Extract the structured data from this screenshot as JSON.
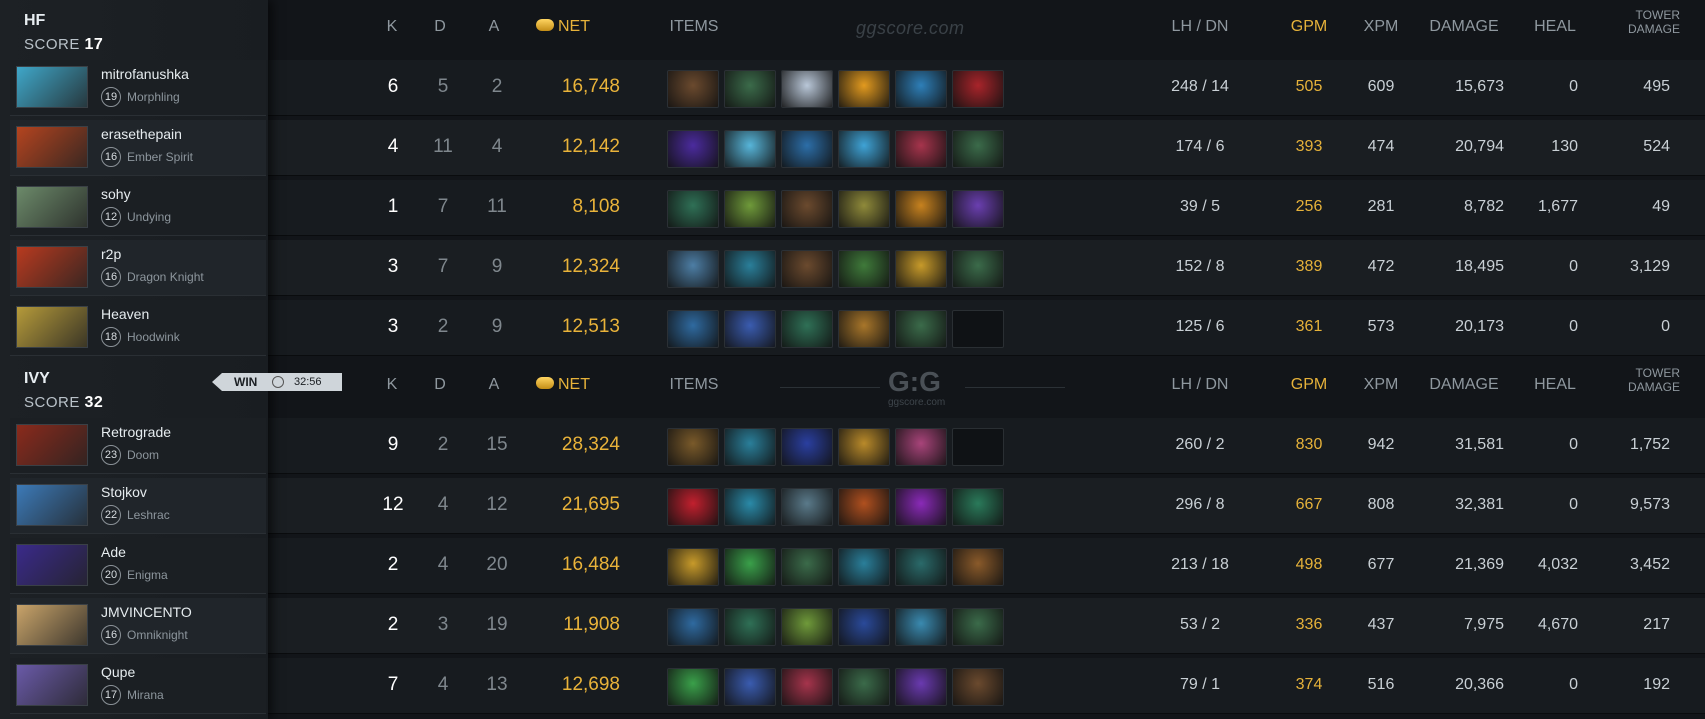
{
  "watermark_text": "ggscore.com",
  "watermark_logo": "G:G",
  "watermark_logo_sub": "ggscore.com",
  "colors": {
    "gold": "#e6b23a",
    "background": "#121519",
    "sidebar": "#1b1f23"
  },
  "headers": {
    "k": "K",
    "d": "D",
    "a": "A",
    "net": "NET",
    "items": "ITEMS",
    "lh_dn": "LH  /  DN",
    "gpm": "GPM",
    "xpm": "XPM",
    "damage": "DAMAGE",
    "heal": "HEAL",
    "tower_damage_1": "TOWER",
    "tower_damage_2": "DAMAGE",
    "net_icon": "gold-coins-icon"
  },
  "win_badge": {
    "label": "WIN",
    "icon": "clock-icon",
    "time": "32:56"
  },
  "teams": [
    {
      "name": "HF",
      "score_label": "SCORE",
      "score": "17",
      "players": [
        {
          "name": "mitrofanushka",
          "level": "19",
          "hero": "Morphling",
          "k": "6",
          "d": "5",
          "a": "2",
          "net": "16,748",
          "lh_dn": "248  /  14",
          "gpm": "505",
          "xpm": "609",
          "damage": "15,673",
          "heal": "0",
          "tower": "495",
          "portrait_color": "#3fa7c9",
          "items": [
            "boots-icon",
            "staff-icon",
            "skull-icon",
            "radiance-icon",
            "orb-icon",
            "blade-icon"
          ],
          "item_colors": [
            "#6b4a2e",
            "#3b6b4a",
            "#b9c7d8",
            "#e29a1f",
            "#2e7fb8",
            "#a8242a"
          ]
        },
        {
          "name": "erasethepain",
          "level": "16",
          "hero": "Ember Spirit",
          "k": "4",
          "d": "11",
          "a": "4",
          "net": "12,142",
          "lh_dn": "174  /  6",
          "gpm": "393",
          "xpm": "474",
          "damage": "20,794",
          "heal": "130",
          "tower": "524",
          "portrait_color": "#b4441f",
          "items": [
            "hat-icon",
            "gem-icon",
            "orb-icon",
            "lightning-icon",
            "crab-icon",
            "staff-icon"
          ],
          "item_colors": [
            "#4b2b9e",
            "#57b5d9",
            "#2c6ea8",
            "#3fa3d6",
            "#a6344c",
            "#3b6b4a"
          ]
        },
        {
          "name": "sohy",
          "level": "12",
          "hero": "Undying",
          "k": "1",
          "d": "7",
          "a": "11",
          "net": "8,108",
          "lh_dn": "39  /  5",
          "gpm": "256",
          "xpm": "281",
          "damage": "8,782",
          "heal": "1,677",
          "tower": "49",
          "portrait_color": "#6c8a6a",
          "items": [
            "staff-icon",
            "drum-icon",
            "boots-icon",
            "mask-icon",
            "bottle-icon",
            "potion-icon"
          ],
          "item_colors": [
            "#2f7056",
            "#6f9a3a",
            "#6b4a2e",
            "#8f8a3a",
            "#c7821f",
            "#6a3fb0"
          ]
        },
        {
          "name": "r2p",
          "level": "16",
          "hero": "Dragon Knight",
          "k": "3",
          "d": "7",
          "a": "9",
          "net": "12,324",
          "lh_dn": "152  /  8",
          "gpm": "389",
          "xpm": "472",
          "damage": "18,495",
          "heal": "0",
          "tower": "3,129",
          "portrait_color": "#b83a1f",
          "items": [
            "hammer-icon",
            "axe-icon",
            "boots-icon",
            "leaf-icon",
            "helm-icon",
            "staff-icon"
          ],
          "item_colors": [
            "#4d7ea5",
            "#2a7f9a",
            "#6b4a2e",
            "#3f7a3a",
            "#c79a2a",
            "#3b6b4a"
          ]
        },
        {
          "name": "Heaven",
          "level": "18",
          "hero": "Hoodwink",
          "k": "3",
          "d": "2",
          "a": "9",
          "net": "12,513",
          "lh_dn": "125  /  6",
          "gpm": "361",
          "xpm": "573",
          "damage": "20,173",
          "heal": "0",
          "tower": "0",
          "portrait_color": "#b59a3a",
          "items": [
            "bracer-icon",
            "wand-icon",
            "staff-icon",
            "bottle-icon",
            "staff-icon",
            "empty-slot"
          ],
          "item_colors": [
            "#2f6aa0",
            "#3a5cb0",
            "#2f7056",
            "#a8762a",
            "#3b6b4a",
            "#0f1215"
          ]
        }
      ]
    },
    {
      "name": "IVY",
      "score_label": "SCORE",
      "score": "32",
      "players": [
        {
          "name": "Retrograde",
          "level": "23",
          "hero": "Doom",
          "k": "9",
          "d": "2",
          "a": "15",
          "net": "28,324",
          "lh_dn": "260  /  2",
          "gpm": "830",
          "xpm": "942",
          "damage": "31,581",
          "heal": "0",
          "tower": "1,752",
          "portrait_color": "#8a2a1c",
          "items": [
            "boots-icon",
            "axe-icon",
            "wand-icon",
            "helm-icon",
            "orb-icon",
            "empty-slot"
          ],
          "item_colors": [
            "#7a5a2a",
            "#2a7f9a",
            "#2a3fa0",
            "#b98a2a",
            "#a8447a",
            "#0f1215"
          ]
        },
        {
          "name": "Stojkov",
          "level": "22",
          "hero": "Leshrac",
          "k": "12",
          "d": "4",
          "a": "12",
          "net": "21,695",
          "lh_dn": "296  /  8",
          "gpm": "667",
          "xpm": "808",
          "damage": "32,381",
          "heal": "0",
          "tower": "9,573",
          "portrait_color": "#3c7ab8",
          "items": [
            "gem-icon",
            "wave-icon",
            "ghost-icon",
            "cape-icon",
            "sword-icon",
            "dagger-icon"
          ],
          "item_colors": [
            "#c2202e",
            "#2a8aa8",
            "#5a7a8a",
            "#b0501f",
            "#8a2ab8",
            "#2a7a5a"
          ]
        },
        {
          "name": "Ade",
          "level": "20",
          "hero": "Enigma",
          "k": "2",
          "d": "4",
          "a": "20",
          "net": "16,484",
          "lh_dn": "213  /  18",
          "gpm": "498",
          "xpm": "677",
          "damage": "21,369",
          "heal": "4,032",
          "tower": "3,452",
          "portrait_color": "#3a2a8a",
          "items": [
            "helm-icon",
            "emerald-icon",
            "staff-icon",
            "axe-icon",
            "boots-icon",
            "crate-icon"
          ],
          "item_colors": [
            "#c79a2a",
            "#3aa04a",
            "#3b6b4a",
            "#2a7f9a",
            "#2a6a6a",
            "#8a5a2a"
          ]
        },
        {
          "name": "JMVINCENTO",
          "level": "16",
          "hero": "Omniknight",
          "k": "2",
          "d": "3",
          "a": "19",
          "net": "11,908",
          "lh_dn": "53  /  2",
          "gpm": "336",
          "xpm": "437",
          "damage": "7,975",
          "heal": "4,670",
          "tower": "217",
          "portrait_color": "#c9a46a",
          "items": [
            "bracer-icon",
            "staff-icon",
            "drum-icon",
            "armor-icon",
            "creature-icon",
            "staff-icon"
          ],
          "item_colors": [
            "#2f6aa0",
            "#2f7056",
            "#6f9a3a",
            "#2a4a9a",
            "#3a8ab0",
            "#3b6b4a"
          ]
        },
        {
          "name": "Qupe",
          "level": "17",
          "hero": "Mirana",
          "k": "7",
          "d": "4",
          "a": "13",
          "net": "12,698",
          "lh_dn": "79  /  1",
          "gpm": "374",
          "xpm": "516",
          "damage": "20,366",
          "heal": "0",
          "tower": "192",
          "portrait_color": "#6a5aa8",
          "items": [
            "dagger-icon",
            "wand-icon",
            "crab-icon",
            "staff-icon",
            "mask-icon",
            "boots-icon"
          ],
          "item_colors": [
            "#3aa04a",
            "#3a5cb0",
            "#a6344c",
            "#3b6b4a",
            "#6a3ab0",
            "#6b4a2e"
          ]
        }
      ]
    }
  ]
}
